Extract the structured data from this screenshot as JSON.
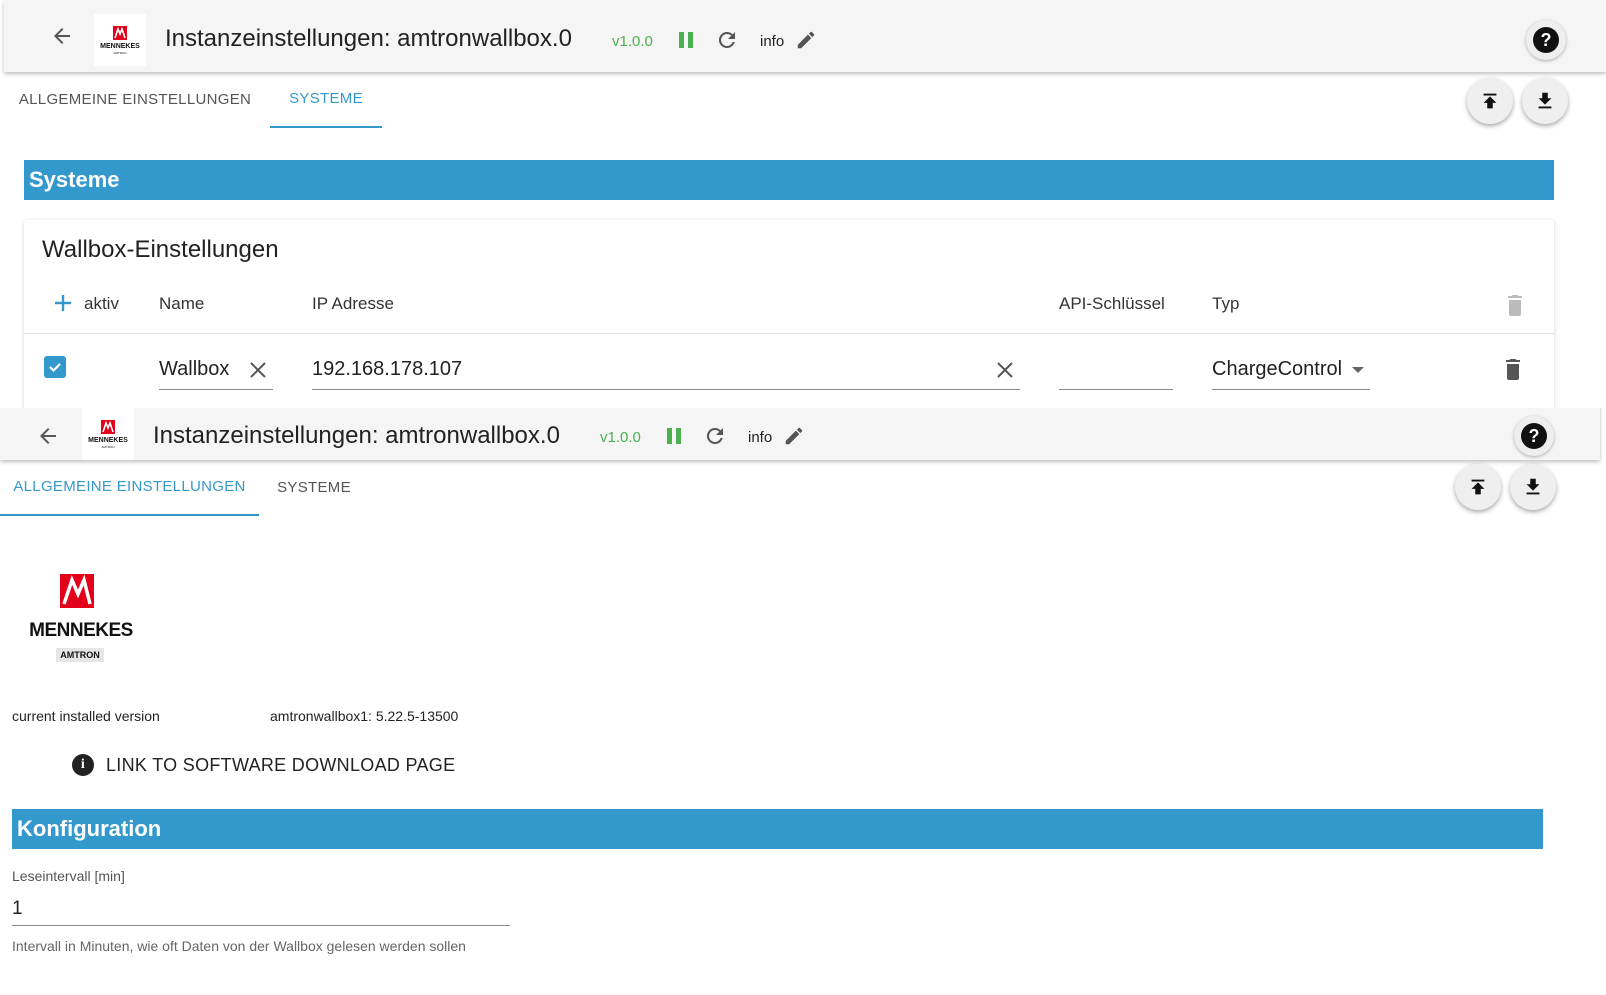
{
  "colors": {
    "accent": "#3399cc",
    "status_green": "#4caf50",
    "brand_red": "#e2001a"
  },
  "header": {
    "title": "Instanzeinstellungen: amtronwallbox.0",
    "version": "v1.0.0",
    "info_label": "info",
    "logo_name": "MENNEKES",
    "logo_sub": "AMTRON",
    "icons": [
      "arrow-back-icon",
      "pause-icon",
      "reload-icon",
      "pencil-icon",
      "help-icon"
    ]
  },
  "tabs": {
    "general": "ALLGEMEINE EINSTELLUNGEN",
    "systems": "SYSTEME"
  },
  "systems": {
    "section_title": "Systeme",
    "card_title": "Wallbox-Einstellungen",
    "columns": {
      "aktiv": "aktiv",
      "name": "Name",
      "ip": "IP Adresse",
      "api": "API-Schlüssel",
      "typ": "Typ"
    },
    "row": {
      "aktiv": true,
      "name": "Wallbox",
      "ip": "192.168.178.107",
      "api": "",
      "typ": "ChargeControl"
    }
  },
  "general": {
    "logo_name": "MENNEKES",
    "logo_sub": "AMTRON",
    "installed_label": "current installed version",
    "installed_value": "amtronwallbox1: 5.22.5-13500",
    "download_link": "LINK TO SOFTWARE DOWNLOAD PAGE",
    "config_title": "Konfiguration",
    "interval_label": "Leseintervall [min]",
    "interval_value": "1",
    "interval_help": "Intervall in Minuten, wie oft Daten von der Wallbox gelesen werden sollen"
  }
}
